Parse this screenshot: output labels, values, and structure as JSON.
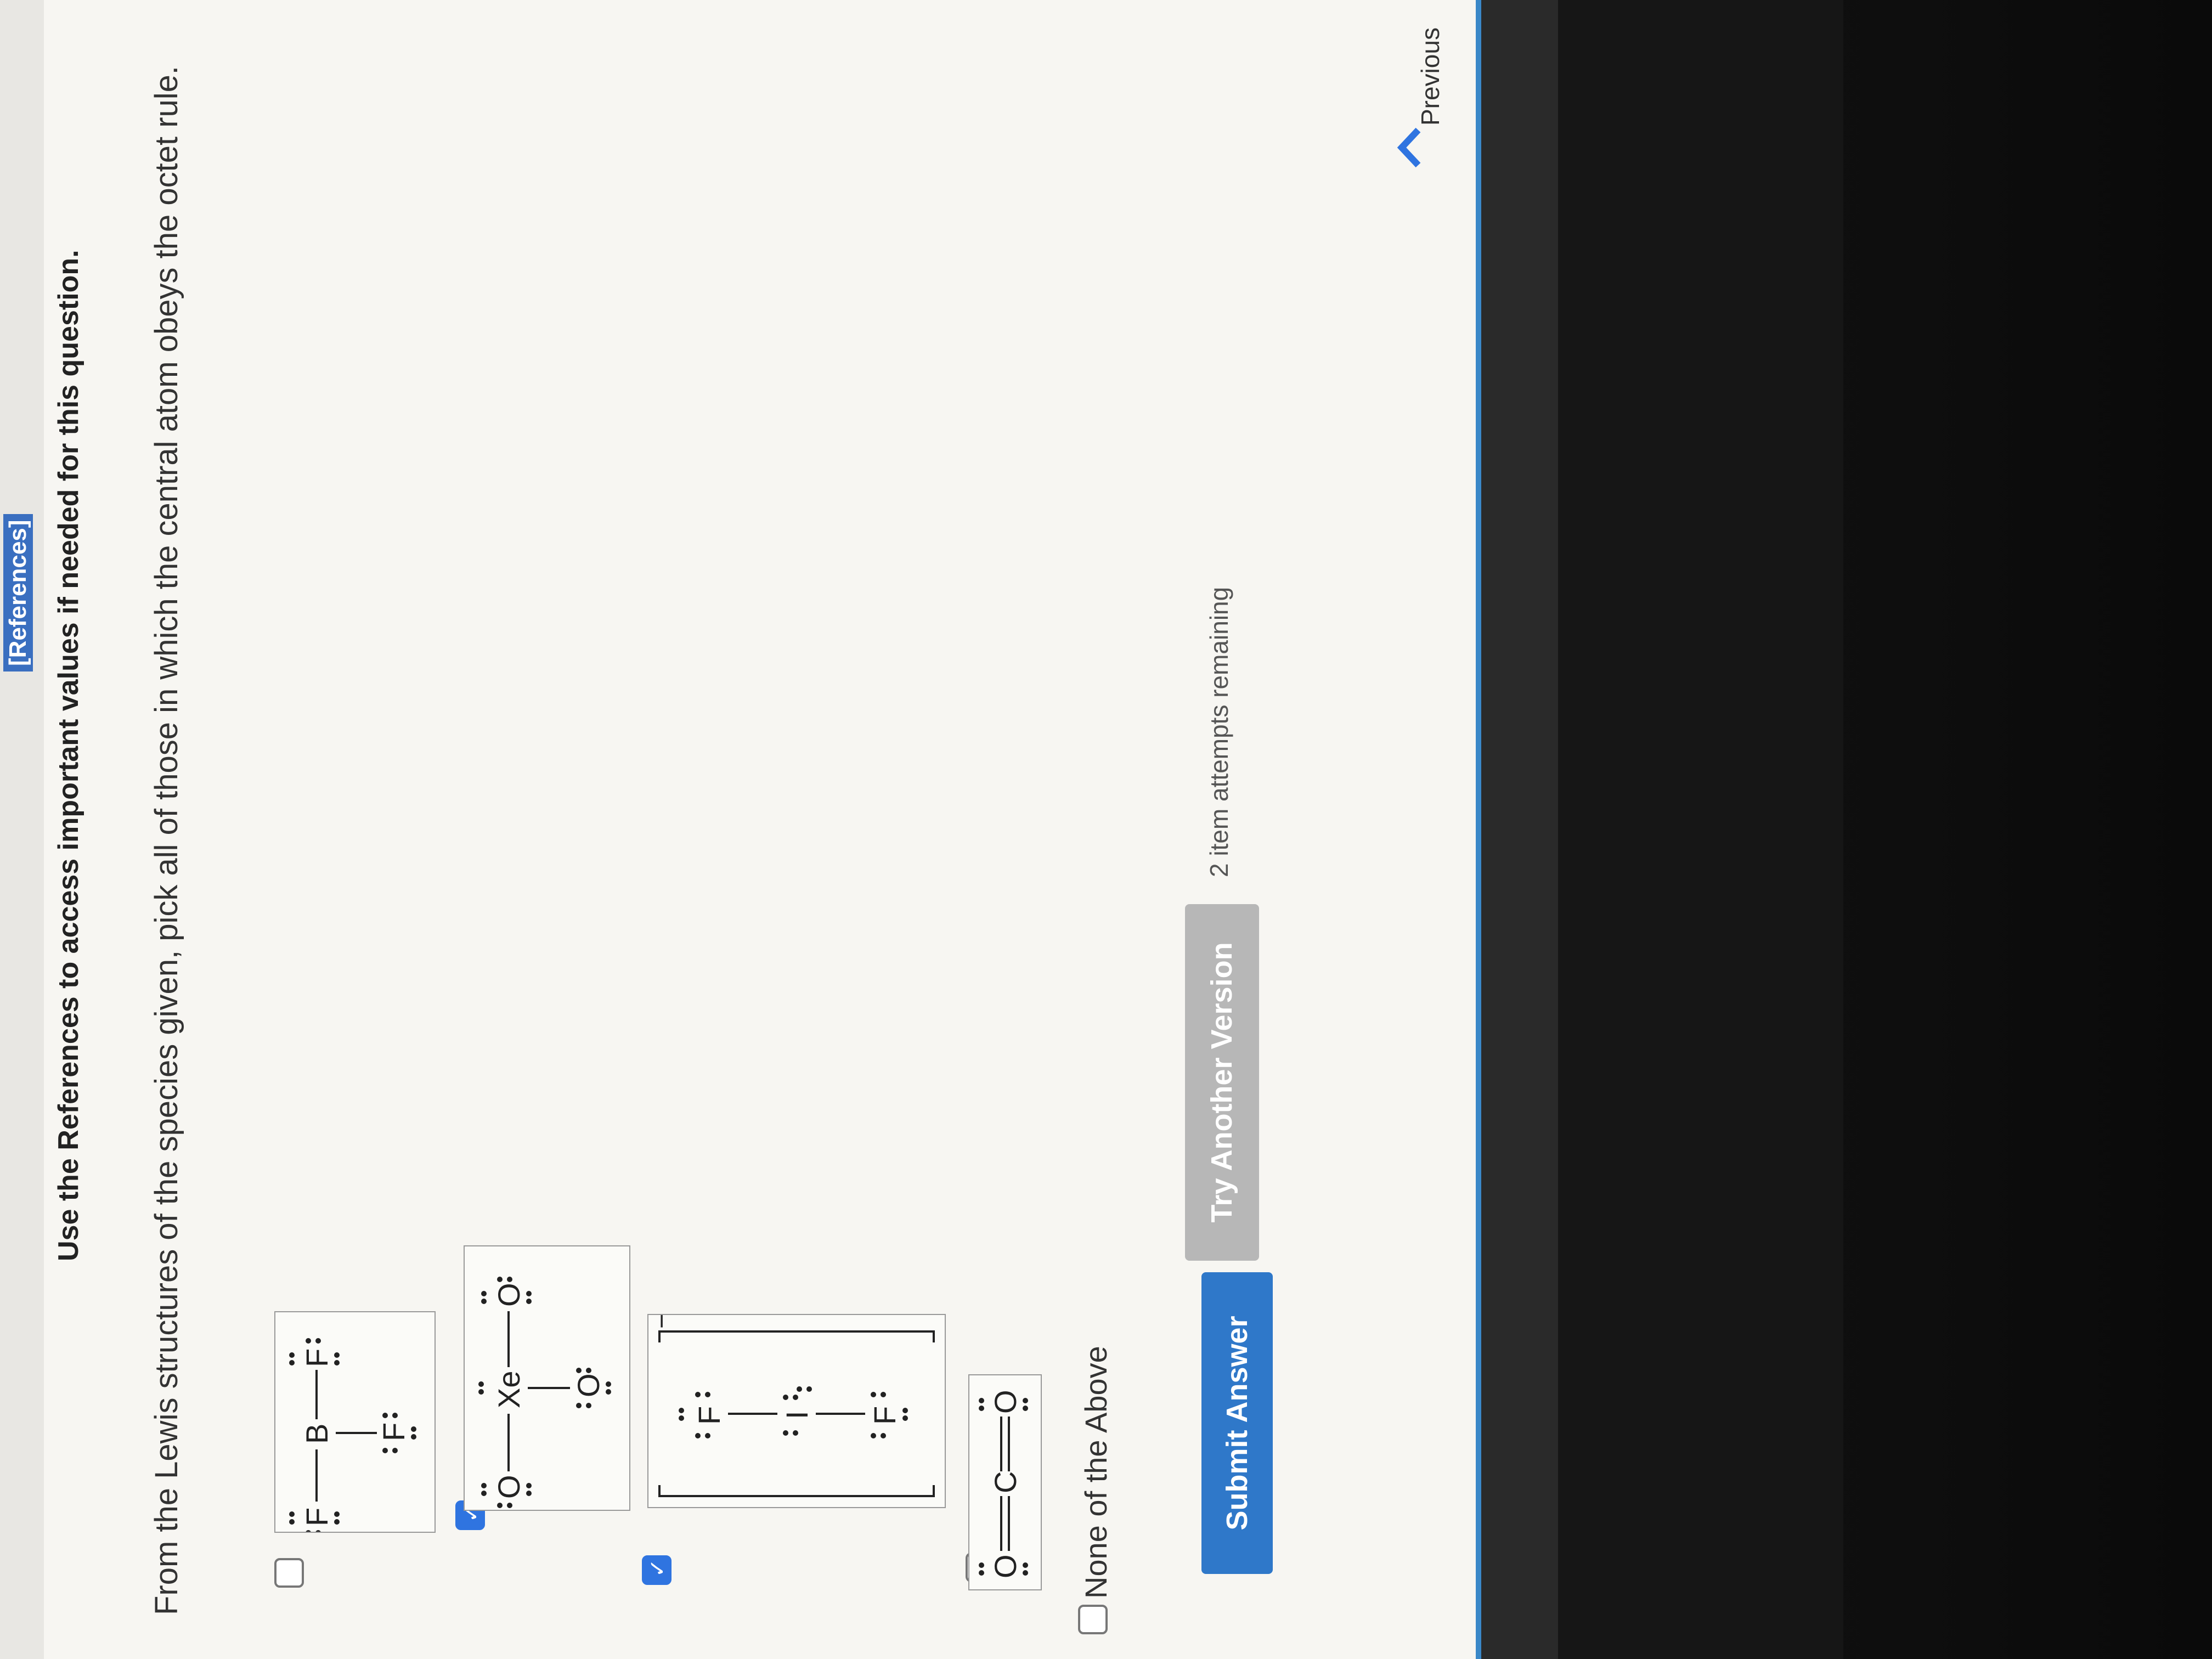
{
  "references_link": "[References]",
  "instruction": "Use the References to access important values if needed for this question.",
  "question": "From the Lewis structures of the species given, pick all of those in which the central atom obeys the octet rule.",
  "options": [
    {
      "id": "bf3",
      "checked": false
    },
    {
      "id": "xeo3",
      "checked": true
    },
    {
      "id": "if2-",
      "checked": true,
      "charge": "−"
    },
    {
      "id": "co2",
      "checked": false
    },
    {
      "id": "none",
      "checked": false,
      "label": "None of the Above"
    }
  ],
  "atoms": {
    "F": "F",
    "B": "B",
    "O": "O",
    "Xe": "Xe",
    "I": "I",
    "C": "C"
  },
  "buttons": {
    "submit": "Submit Answer",
    "try_another": "Try Another Version"
  },
  "attempts": "2 item attempts remaining",
  "nav": {
    "previous": "Previous"
  },
  "colors": {
    "accent": "#2f74e0",
    "submit_bg": "#2f78c9",
    "try_bg": "#b7b7b7"
  }
}
